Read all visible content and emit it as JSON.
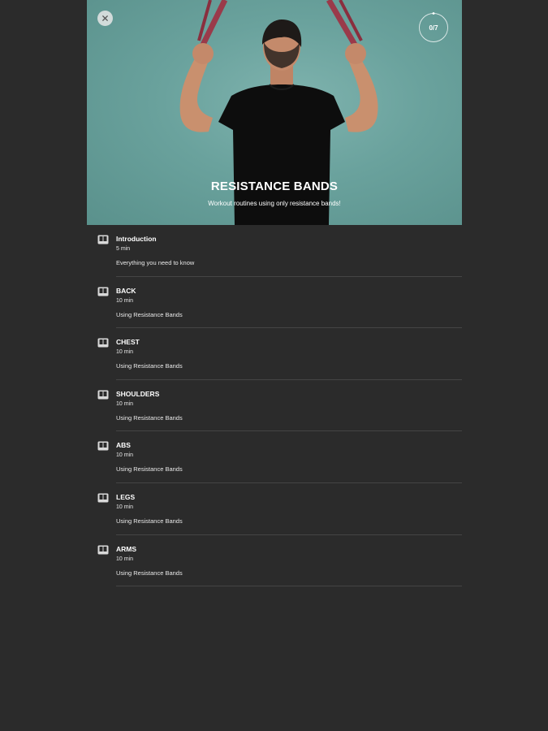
{
  "hero": {
    "title": "RESISTANCE BANDS",
    "subtitle": "Workout routines using only resistance bands!",
    "progress_text": "0/7",
    "progress_fraction": 0
  },
  "icons": {
    "close": "close-icon",
    "lesson": "book-icon"
  },
  "colors": {
    "background": "#2b2b2b",
    "hero_bg": "#6aa29d",
    "divider": "#454545",
    "text": "#ffffff"
  },
  "lessons": [
    {
      "title": "Introduction",
      "duration": "5 min",
      "description": "Everything you need to know"
    },
    {
      "title": "BACK",
      "duration": "10 min",
      "description": "Using Resistance Bands"
    },
    {
      "title": "CHEST",
      "duration": "10 min",
      "description": "Using Resistance Bands"
    },
    {
      "title": "SHOULDERS",
      "duration": "10 min",
      "description": "Using Resistance Bands"
    },
    {
      "title": "ABS",
      "duration": "10 min",
      "description": "Using Resistance Bands"
    },
    {
      "title": "LEGS",
      "duration": "10 min",
      "description": "Using Resistance Bands"
    },
    {
      "title": "ARMS",
      "duration": "10 min",
      "description": "Using Resistance Bands"
    }
  ]
}
